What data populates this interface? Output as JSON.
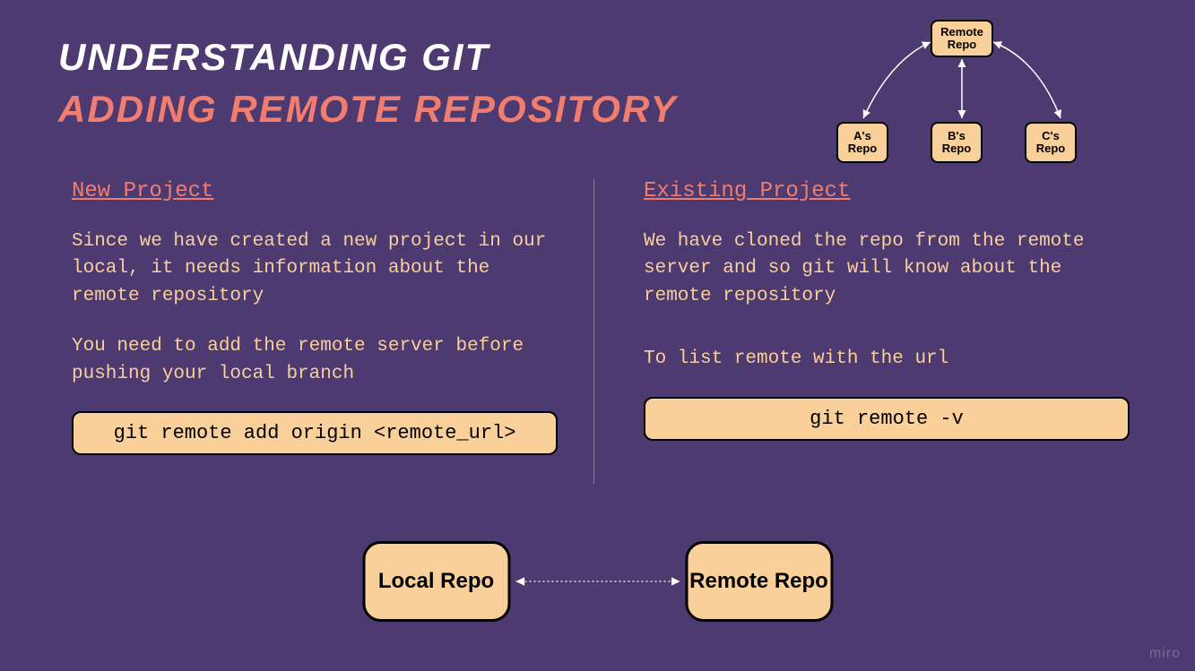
{
  "title": {
    "main": "Understanding Git",
    "sub": "Adding Remote Repository"
  },
  "tree": {
    "remote": "Remote Repo",
    "a": "A's Repo",
    "b": "B's Repo",
    "c": "C's Repo"
  },
  "left": {
    "heading": "New Project",
    "p1": "Since we have created a new project in our local, it needs information about the remote repository",
    "p2": "You need to add the remote server before pushing your local branch",
    "cmd": "git remote add origin <remote_url>"
  },
  "right": {
    "heading": "Existing Project",
    "p1": "We have cloned the repo from the remote server and so git will know about the remote repository",
    "p2": "To list remote with the url",
    "cmd": "git remote -v"
  },
  "bottom": {
    "local": "Local Repo",
    "remote": "Remote Repo"
  },
  "watermark": "miro"
}
